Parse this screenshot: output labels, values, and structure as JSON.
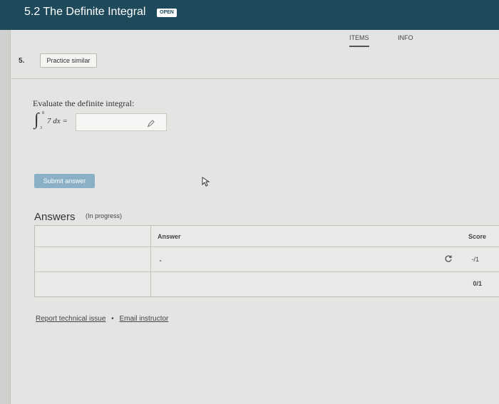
{
  "header": {
    "title": "5.2 The Definite Integral",
    "badge": "OPEN"
  },
  "tabs": [
    {
      "label": "ITEMS",
      "active": true
    },
    {
      "label": "INFO",
      "active": false
    }
  ],
  "question": {
    "number": "5.",
    "practice_label": "Practice similar",
    "prompt": "Evaluate the definite integral:",
    "integral": {
      "upper": "8",
      "lower": "3",
      "integrand": "7 dx ="
    },
    "answer_value": "",
    "submit_label": "Submit answer"
  },
  "answers": {
    "heading": "Answers",
    "status": "(In progress)",
    "columns": [
      "Answer",
      "Score"
    ],
    "rows": [
      {
        "answer": "",
        "score": "-/1"
      },
      {
        "answer": "",
        "score": "0/1"
      }
    ]
  },
  "footer": {
    "report_label": "Report technical issue",
    "separator": "•",
    "email_label": "Email instructor"
  },
  "colors": {
    "topbar": "#1f4a5c",
    "submit": "#8ab0c6"
  }
}
